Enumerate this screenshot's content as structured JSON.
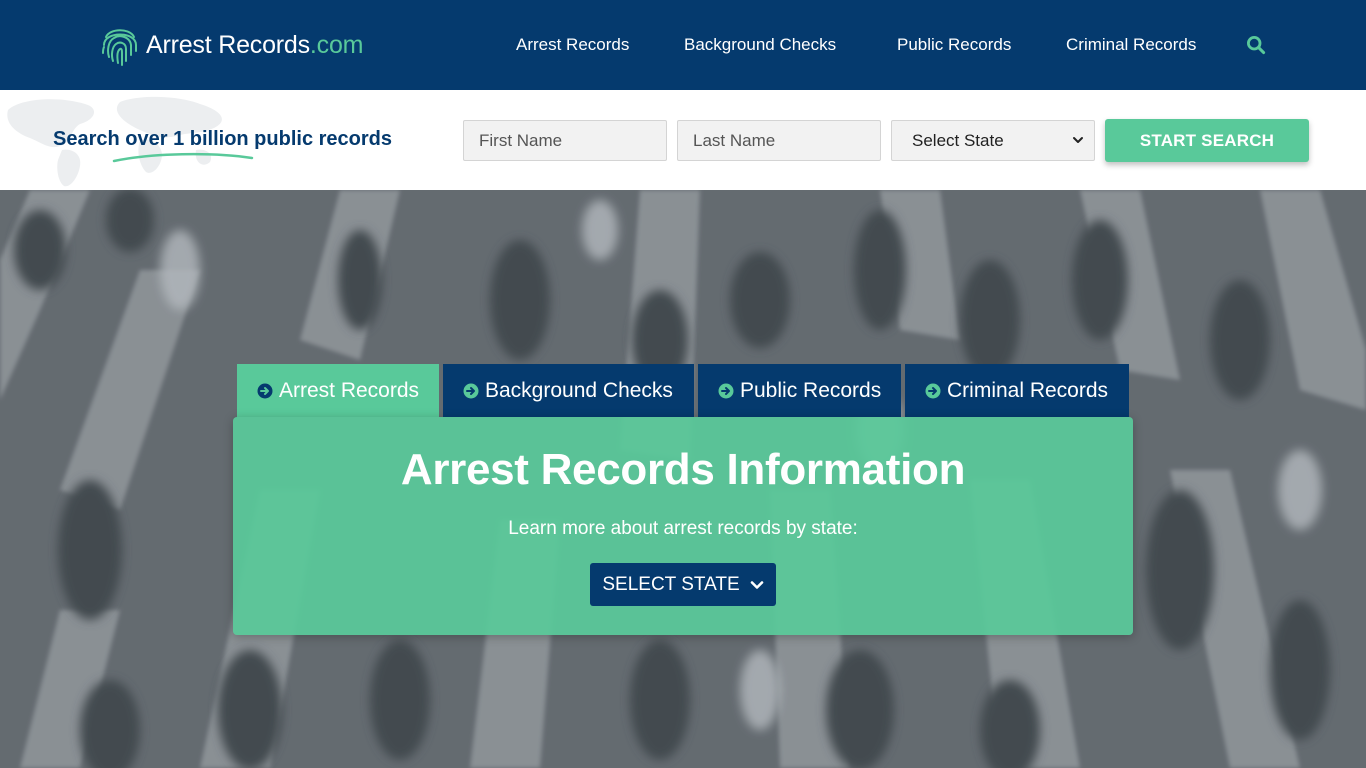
{
  "header": {
    "logo": {
      "brand": "Arrest Records",
      "tld": ".com"
    },
    "nav": [
      {
        "label": "Arrest Records"
      },
      {
        "label": "Background Checks"
      },
      {
        "label": "Public Records"
      },
      {
        "label": "Criminal Records"
      }
    ],
    "search_icon": "search-icon"
  },
  "search": {
    "tagline": "Search over 1 billion public records",
    "first_name_placeholder": "First Name",
    "last_name_placeholder": "Last Name",
    "state_select_value": "Select State",
    "submit_label": "START SEARCH"
  },
  "hero": {
    "tabs": [
      {
        "label": "Arrest Records",
        "active": true
      },
      {
        "label": "Background Checks",
        "active": false
      },
      {
        "label": "Public Records",
        "active": false
      },
      {
        "label": "Criminal Records",
        "active": false
      }
    ],
    "card": {
      "title": "Arrest Records Information",
      "subtitle": "Learn more about arrest records by state:",
      "button_label": "SELECT STATE"
    }
  },
  "colors": {
    "navy": "#053a6e",
    "green": "#59c99a",
    "white": "#ffffff"
  },
  "icons": [
    "fingerprint-icon",
    "search-icon",
    "arrow-circle-right-icon",
    "chevron-down-icon"
  ]
}
